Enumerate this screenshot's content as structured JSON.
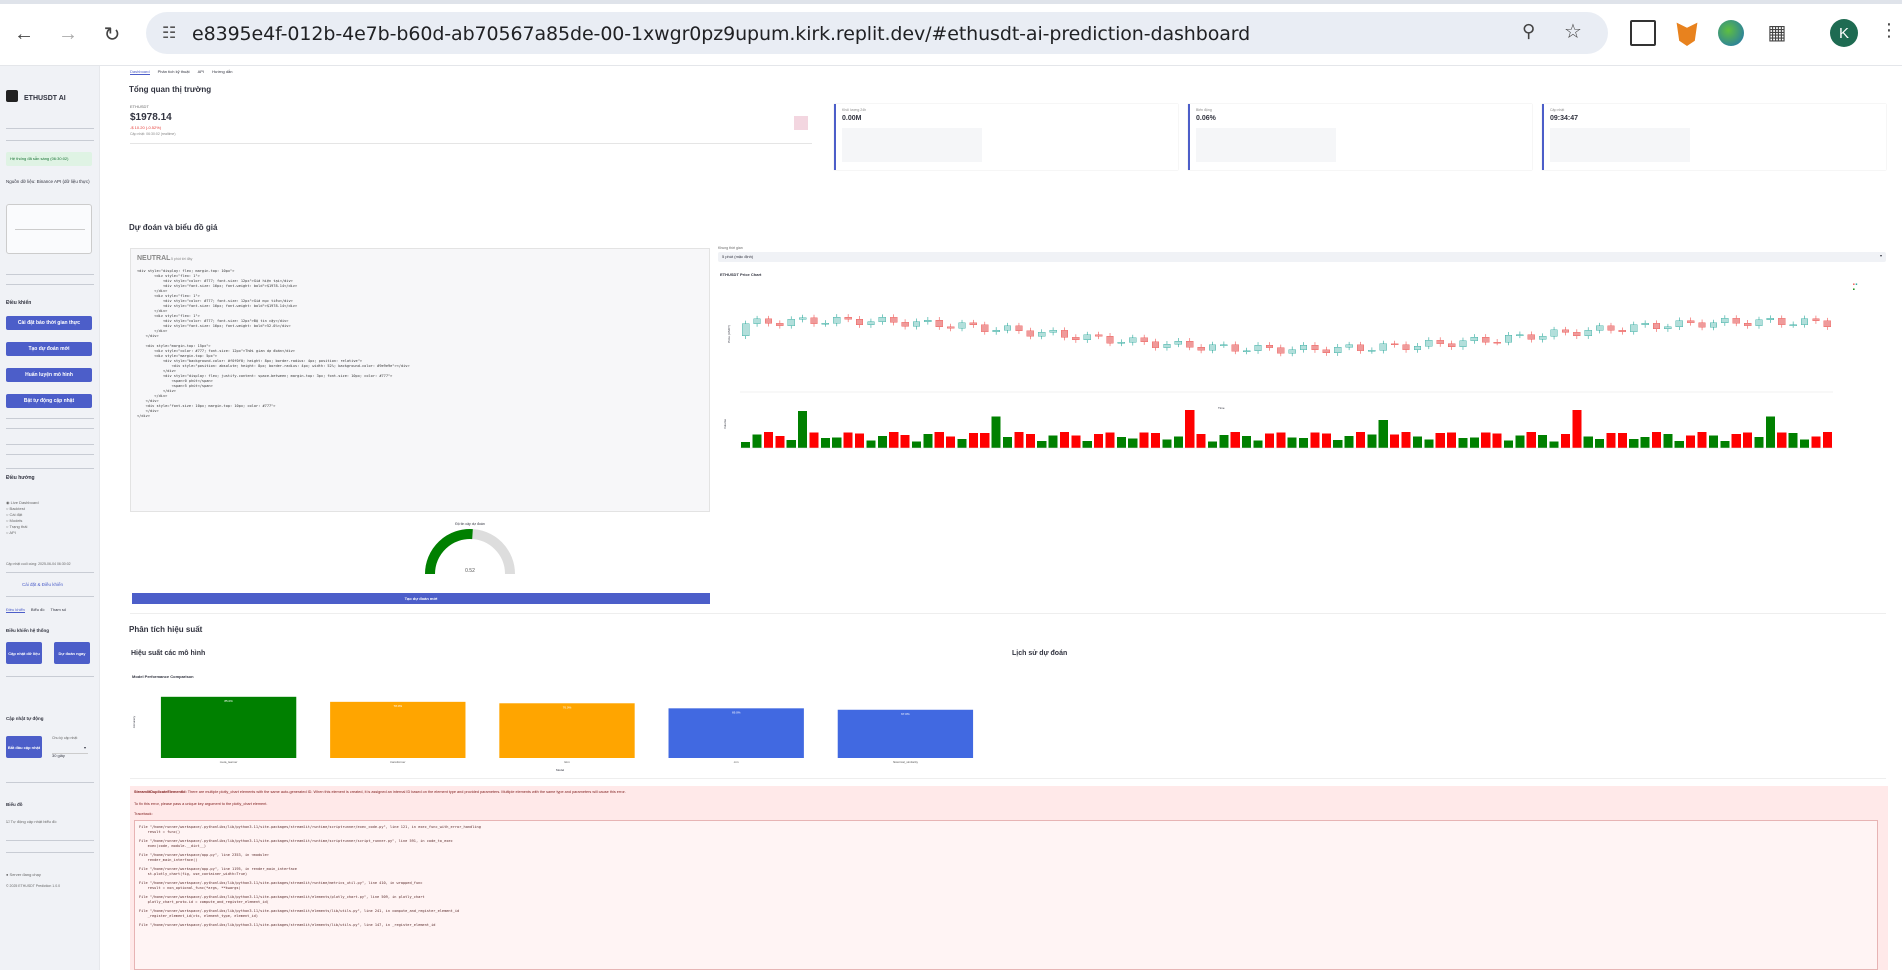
{
  "browser": {
    "url": "e8395e4f-012b-4e7b-b60d-ab70567a85de-00-1xwgr0pz9upum.kirk.replit.dev/#ethusdt-ai-prediction-dashboard",
    "avatar_letter": "K"
  },
  "sidebar": {
    "app_title": "ETHUSDT AI",
    "status_success": "Hệ thống đã sẵn sàng (06:30:02)",
    "data_source": "Nguồn dữ liệu: Binance API (dữ liệu thực)",
    "controls_heading": "Điều khiển",
    "buttons": [
      "Cài đặt bảo thời gian thực",
      "Tạo dự đoán mới",
      "Huấn luyện mô hình",
      "Bật tự động cập nhật"
    ],
    "nav_heading": "Điều hướng",
    "nav_items": [
      "Live Dashboard",
      "Backtest",
      "Cài đặt",
      "Models",
      "Trạng thái",
      "API"
    ],
    "last_update": "Cập nhật cuối cùng: 2025-06-04 06:30:02",
    "settings_link": "Cài đặt & Điều khiển",
    "tabs": [
      "Điều khiển",
      "Biểu đồ",
      "Tham số"
    ],
    "system_control_heading": "Điều khiển hệ thống",
    "update_data_btn": "Cập nhật dữ liệu",
    "predict_now_btn": "Dự đoán ngay",
    "auto_update_heading": "Cập nhật tự động",
    "start_update_btn": "Bắt đầu cập nhật",
    "interval_label": "Chu kỳ cập nhật",
    "interval_value": "30 giây",
    "chart_heading": "Biểu đồ",
    "auto_chart_label": "Tự động cập nhật biểu đồ",
    "footer_running": "Server đang chạy",
    "footer_copy": "© 2025 ETHUSDT Prediction 1.0.0"
  },
  "main": {
    "tabs": [
      "Dashboard",
      "Phân tích kỹ thuật",
      "API",
      "Hướng dẫn"
    ],
    "market_overview_title": "Tổng quan thị trường",
    "price_card": {
      "label": "ETHUSDT",
      "price": "$1978.14",
      "change": "-$ 10.20 (-0.52%)",
      "updated": "Cập nhật: 06:30:02 (realtime)"
    },
    "metric_cards": [
      {
        "label": "Khối lượng 24h",
        "value": "0.00M"
      },
      {
        "label": "Biến động",
        "value": "0.06%"
      },
      {
        "label": "Cập nhật",
        "value": "09:34:47"
      }
    ],
    "predict_section_title": "Dự đoán và biểu đồ giá",
    "prediction_label": "NEUTRAL",
    "prediction_sub": "5 phút tới đây",
    "timeframe_label": "Khung thời gian",
    "timeframe_value": "5 phút (mặc định)",
    "chart_title": "ETHUSDT Price Chart",
    "chart_ylabel": "Price (USDT)",
    "chart_vol_label": "Volume",
    "chart_xlabel": "Time",
    "gauge_title": "Độ tin cậy dự đoán",
    "gauge_value": "0.52",
    "new_prediction_btn": "Tạo dự đoán mới",
    "perf_section_title": "Phân tích hiệu suất",
    "perf_models_title": "Hiệu suất các mô hình",
    "history_title": "Lịch sử dự đoán",
    "perf_chart_title": "Model Performance Comparison",
    "perf_xlabel": "Model",
    "perf_ylabel": "Accuracy",
    "error_title": "StreamlitDuplicateElementId:",
    "error_text": "There are multiple plotly_chart elements with the same auto-generated ID. When this element is created, it is assigned an internal ID based on the element type and provided parameters. Multiple elements with the same type and parameters will cause this error.",
    "error_fix": "To fix this error, please pass a unique key argument to the plotly_chart element.",
    "traceback_label": "Traceback:",
    "traceback": [
      "File \"/home/runner/workspace/.pythonlibs/lib/python3.11/site-packages/streamlit/runtime/scriptrunner/exec_code.py\", line 121, in exec_func_with_error_handling",
      "    result = func()",
      "File \"/home/runner/workspace/.pythonlibs/lib/python3.11/site-packages/streamlit/runtime/scriptrunner/script_runner.py\", line 591, in code_to_exec",
      "    exec(code, module.__dict__)",
      "File \"/home/runner/workspace/app.py\", line 2353, in <module>",
      "    render_main_interface()",
      "File \"/home/runner/workspace/app.py\", line 1195, in render_main_interface",
      "    st.plotly_chart(fig, use_container_width=True)",
      "File \"/home/runner/workspace/.pythonlibs/lib/python3.11/site-packages/streamlit/runtime/metrics_util.py\", line 410, in wrapped_func",
      "    result = non_optional_func(*args, **kwargs)",
      "File \"/home/runner/workspace/.pythonlibs/lib/python3.11/site-packages/streamlit/elements/plotly_chart.py\", line 509, in plotly_chart",
      "    plotly_chart_proto.id = compute_and_register_element_id(",
      "File \"/home/runner/workspace/.pythonlibs/lib/python3.11/site-packages/streamlit/elements/lib/utils.py\", line 241, in compute_and_register_element_id",
      "    _register_element_id(ctx, element_type, element_id)",
      "File \"/home/runner/workspace/.pythonlibs/lib/python3.11/site-packages/streamlit/elements/lib/utils.py\", line 147, in _register_element_id"
    ]
  },
  "chart_data": [
    {
      "type": "bar",
      "title": "Model Performance Comparison",
      "xlabel": "Model",
      "ylabel": "Accuracy",
      "categories": [
        "meta_learner",
        "transformer",
        "lstm",
        "cnn",
        "historical_similarity"
      ],
      "values": [
        0.85,
        0.78,
        0.76,
        0.69,
        0.67
      ],
      "labels": [
        "85.0%",
        "78.0%",
        "76.0%",
        "69.0%",
        "67.0%"
      ],
      "colors": [
        "#008000",
        "#ffa500",
        "#ffa500",
        "#4169e1",
        "#4169e1"
      ],
      "ylim": [
        0,
        1
      ]
    },
    {
      "type": "gauge",
      "title": "Độ tin cậy dự đoán",
      "value": 0.52,
      "range": [
        0,
        1
      ]
    }
  ],
  "colors": {
    "accent": "#4c5ec9",
    "up": "#26a69a",
    "down": "#ef5350",
    "vol_up": "#008000",
    "vol_down": "#ff0000"
  }
}
